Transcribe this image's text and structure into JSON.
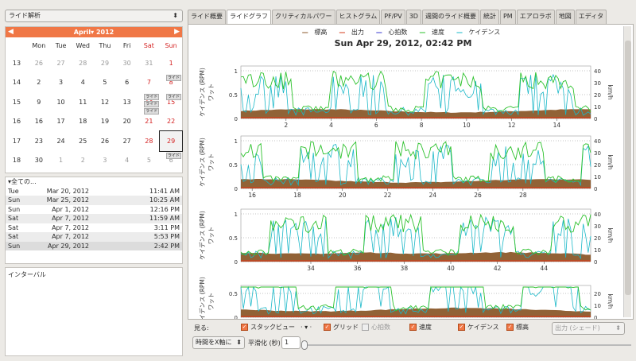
{
  "left": {
    "dropdown": "ライド解析",
    "calendar": {
      "month": "April",
      "year": "2012",
      "weekdays": [
        "Mon",
        "Tue",
        "Wed",
        "Thu",
        "Fri",
        "Sat",
        "Sun"
      ],
      "weeks": [
        {
          "wk": "13",
          "days": [
            "26",
            "27",
            "28",
            "29",
            "30",
            "31",
            "1"
          ]
        },
        {
          "wk": "14",
          "days": [
            "2",
            "3",
            "4",
            "5",
            "6",
            "7",
            "8"
          ]
        },
        {
          "wk": "15",
          "days": [
            "9",
            "10",
            "11",
            "12",
            "13",
            "14",
            "15"
          ]
        },
        {
          "wk": "16",
          "days": [
            "16",
            "17",
            "18",
            "19",
            "20",
            "21",
            "22"
          ]
        },
        {
          "wk": "17",
          "days": [
            "23",
            "24",
            "25",
            "26",
            "27",
            "28",
            "29"
          ]
        },
        {
          "wk": "18",
          "days": [
            "30",
            "1",
            "2",
            "3",
            "4",
            "5",
            "6"
          ]
        }
      ],
      "ride_tag": "ライド"
    },
    "list": {
      "header": "全ての...",
      "rows": [
        {
          "day": "Tue",
          "date": "Mar 20, 2012",
          "time": "11:41 AM"
        },
        {
          "day": "Sun",
          "date": "Mar 25, 2012",
          "time": "10:25 AM"
        },
        {
          "day": "Sun",
          "date": "Apr 1, 2012",
          "time": "12:16 PM"
        },
        {
          "day": "Sat",
          "date": "Apr 7, 2012",
          "time": "11:59 AM"
        },
        {
          "day": "Sat",
          "date": "Apr 7, 2012",
          "time": "3:11 PM"
        },
        {
          "day": "Sat",
          "date": "Apr 7, 2012",
          "time": "5:53 PM"
        },
        {
          "day": "Sun",
          "date": "Apr 29, 2012",
          "time": "2:42 PM"
        }
      ]
    },
    "interval_label": "インターバル"
  },
  "tabs": [
    "ライド概要",
    "ライドグラフ",
    "クリティカルパワー",
    "ヒストグラム",
    "PF/PV",
    "3D",
    "週間のライド概要",
    "統計",
    "PM",
    "エアロラボ",
    "地図",
    "エディタ"
  ],
  "active_tab": "ライドグラフ",
  "chart_data": {
    "type": "line",
    "title": "Sun Apr 29, 2012, 02:42 PM",
    "legend": [
      "標高",
      "出力",
      "心拍数",
      "速度",
      "ケイデンス"
    ],
    "colors": {
      "標高": "#8b5a2b",
      "出力": "#d43c1c",
      "心拍数": "#3a3ad0",
      "速度": "#2ec22e",
      "ケイデンス": "#1ab8c8"
    },
    "left_axis_labels": [
      "ケイデンス (RPM)",
      "ワット"
    ],
    "right_axis_label": "km/h",
    "left_ticks": [
      "0",
      "0.5",
      "1"
    ],
    "right_ticks": [
      "0",
      "10",
      "20",
      "30",
      "40"
    ],
    "x_unit": "minutes",
    "panels": [
      {
        "xlim": [
          0,
          15.5
        ],
        "xticks": [
          "2",
          "4",
          "6",
          "8",
          "10",
          "12",
          "14"
        ]
      },
      {
        "xlim": [
          15.5,
          31
        ],
        "xticks": [
          "16",
          "18",
          "20",
          "22",
          "24",
          "26",
          "28"
        ]
      },
      {
        "xlim": [
          31,
          46
        ],
        "xticks": [
          "34",
          "36",
          "38",
          "40",
          "42",
          "44"
        ]
      },
      {
        "xlim": [
          46,
          61
        ],
        "xticks": []
      }
    ]
  },
  "controls": {
    "show_label": "見る:",
    "stack": "スタックビュー",
    "grid": "グリッド",
    "hr": "心拍数",
    "speed": "速度",
    "cadence": "ケイデンス",
    "altitude": "標高",
    "power_select": "出力 (シェード)",
    "xaxis_select": "時間をX軸に",
    "smooth_label": "平滑化 (秒)",
    "smooth_value": "1"
  }
}
